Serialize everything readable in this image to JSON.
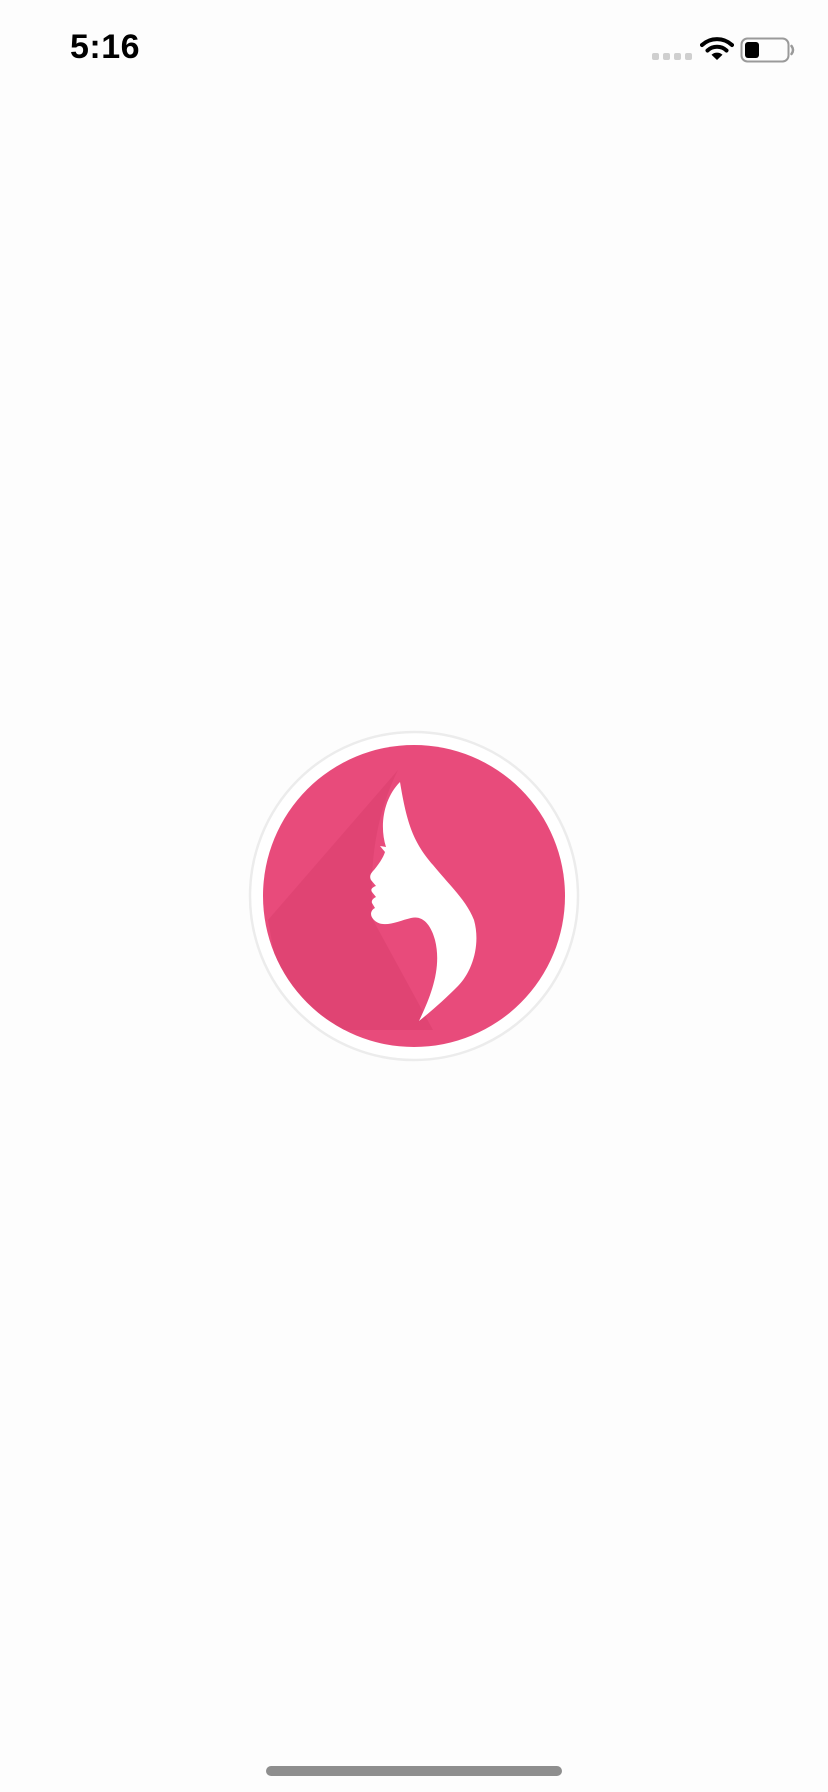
{
  "status_bar": {
    "time": "5:16",
    "signal_icon": "cellular-signal-icon",
    "wifi_icon": "wifi-icon",
    "battery_icon": "battery-icon",
    "battery_level": 0.35
  },
  "splash": {
    "logo_icon": "woman-profile-logo-icon"
  },
  "colors": {
    "background": "#fdfdfd",
    "brand_pink": "#e84b7b",
    "brand_pink_dark": "#d9406e",
    "logo_ring": "#ffffff",
    "signal_inactive": "#cfcfcf",
    "home_indicator": "#8e8e8e",
    "text": "#000000"
  }
}
